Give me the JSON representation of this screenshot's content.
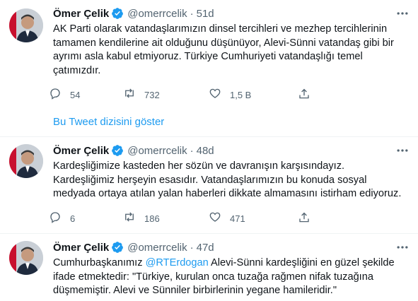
{
  "tweets": [
    {
      "name": "Ömer Çelik",
      "handle": "@omerrcelik",
      "dot": "·",
      "time": "51d",
      "text": "AK Parti olarak vatandaşlarımızın dinsel tercihleri ve mezhep tercihlerinin tamamen kendilerine ait olduğunu düşünüyor, Alevi-Sünni vatandaş gibi bir ayrımı asla kabul etmiyoruz. Türkiye Cumhuriyeti vatandaşlığı temel çatımızdır.",
      "replies": "54",
      "retweets": "732",
      "likes": "1,5 B"
    },
    {
      "name": "Ömer Çelik",
      "handle": "@omerrcelik",
      "dot": "·",
      "time": "48d",
      "text": "Kardeşliğimize kasteden her sözün ve davranışın karşısındayız. Kardeşliğimiz herşeyin esasıdır. Vatandaşlarımızın bu konuda sosyal medyada ortaya atılan yalan haberleri dikkate almamasını istirham ediyoruz.",
      "replies": "6",
      "retweets": "186",
      "likes": "471"
    },
    {
      "name": "Ömer Çelik",
      "handle": "@omerrcelik",
      "dot": "·",
      "time": "47d",
      "text_before": "Cumhurbaşkanımız ",
      "mention": "@RTErdogan",
      "text_after": " Alevi-Sünni kardeşliğini en güzel şekilde ifade etmektedir: \"Türkiye, kurulan onca tuzağa rağmen nifak tuzağına düşmemiştir. Alevi ve Sünniler birbirlerinin yegane hamileridir.\""
    }
  ],
  "thread_link": "Bu Tweet dizisini göster",
  "colors": {
    "accent": "#1d9bf0",
    "text": "#0f1419",
    "secondary": "#536471",
    "divider": "#eff3f4"
  }
}
